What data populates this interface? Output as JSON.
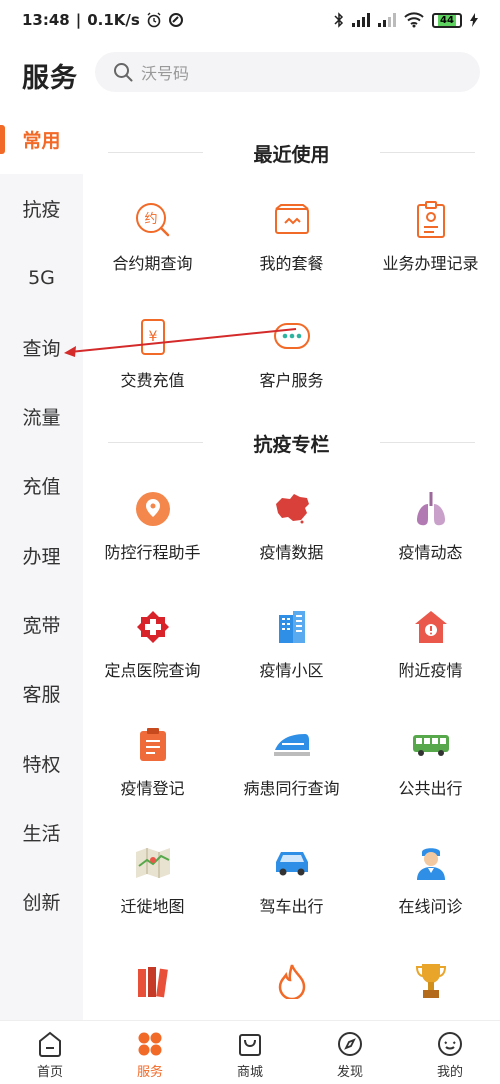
{
  "status_bar": {
    "time": "13:48",
    "speed": "0.1K/s",
    "battery": "44"
  },
  "header": {
    "title": "服务",
    "search_placeholder": "沃号码"
  },
  "sidebar": {
    "items": [
      {
        "label": "常用",
        "active": true
      },
      {
        "label": "抗疫"
      },
      {
        "label": "5G"
      },
      {
        "label": "查询"
      },
      {
        "label": "流量"
      },
      {
        "label": "充值"
      },
      {
        "label": "办理"
      },
      {
        "label": "宽带"
      },
      {
        "label": "客服"
      },
      {
        "label": "特权"
      },
      {
        "label": "生活"
      },
      {
        "label": "创新"
      }
    ]
  },
  "sections": [
    {
      "title": "最近使用",
      "items": [
        {
          "label": "合约期查询",
          "icon": "contract-icon"
        },
        {
          "label": "我的套餐",
          "icon": "package-icon"
        },
        {
          "label": "业务办理记录",
          "icon": "record-icon"
        },
        {
          "label": "交费充值",
          "icon": "recharge-icon"
        },
        {
          "label": "客户服务",
          "icon": "chat-icon"
        }
      ]
    },
    {
      "title": "抗疫专栏",
      "items": [
        {
          "label": "防控行程助手",
          "icon": "location-pin-icon"
        },
        {
          "label": "疫情数据",
          "icon": "china-map-icon"
        },
        {
          "label": "疫情动态",
          "icon": "lungs-icon"
        },
        {
          "label": "定点医院查询",
          "icon": "medical-cross-icon"
        },
        {
          "label": "疫情小区",
          "icon": "building-icon"
        },
        {
          "label": "附近疫情",
          "icon": "house-alert-icon"
        },
        {
          "label": "疫情登记",
          "icon": "clipboard-icon"
        },
        {
          "label": "病患同行查询",
          "icon": "train-icon"
        },
        {
          "label": "公共出行",
          "icon": "bus-icon"
        },
        {
          "label": "迁徙地图",
          "icon": "folded-map-icon"
        },
        {
          "label": "驾车出行",
          "icon": "car-icon"
        },
        {
          "label": "在线问诊",
          "icon": "doctor-icon"
        },
        {
          "label": "",
          "icon": "books-icon"
        },
        {
          "label": "",
          "icon": "flame-icon"
        },
        {
          "label": "",
          "icon": "trophy-icon"
        }
      ]
    }
  ],
  "tabbar": {
    "items": [
      {
        "label": "首页",
        "icon": "home-icon"
      },
      {
        "label": "服务",
        "icon": "service-grid-icon",
        "active": true
      },
      {
        "label": "商城",
        "icon": "shopping-bag-icon"
      },
      {
        "label": "发现",
        "icon": "compass-icon"
      },
      {
        "label": "我的",
        "icon": "profile-icon"
      }
    ]
  },
  "colors": {
    "accent": "#f26a28",
    "sidebar_bg": "#f6f6f8",
    "annotation_arrow": "#d42a2a"
  }
}
